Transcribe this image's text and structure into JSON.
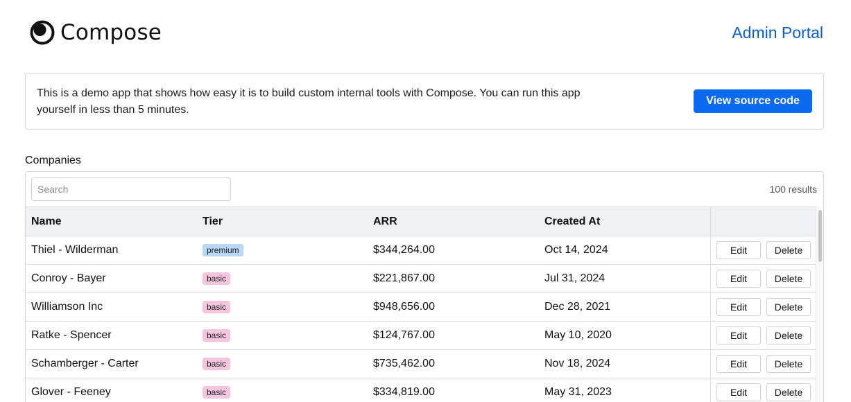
{
  "header": {
    "brand": "Compose",
    "portal_link": "Admin Portal"
  },
  "banner": {
    "text": "This is a demo app that shows how easy it is to build custom internal tools with Compose. You can run this app yourself in less than 5 minutes.",
    "button": "View source code"
  },
  "companies": {
    "title": "Companies",
    "search_placeholder": "Search",
    "results": "100 results",
    "columns": [
      "Name",
      "Tier",
      "ARR",
      "Created At"
    ],
    "edit_label": "Edit",
    "delete_label": "Delete",
    "rows": [
      {
        "name": "Thiel - Wilderman",
        "tier": "premium",
        "arr": "$344,264.00",
        "created": "Oct 14, 2024"
      },
      {
        "name": "Conroy - Bayer",
        "tier": "basic",
        "arr": "$221,867.00",
        "created": "Jul 31, 2024"
      },
      {
        "name": "Williamson Inc",
        "tier": "basic",
        "arr": "$948,656.00",
        "created": "Dec 28, 2021"
      },
      {
        "name": "Ratke - Spencer",
        "tier": "basic",
        "arr": "$124,767.00",
        "created": "May 10, 2020"
      },
      {
        "name": "Schamberger - Carter",
        "tier": "basic",
        "arr": "$735,462.00",
        "created": "Nov 18, 2024"
      },
      {
        "name": "Glover - Feeney",
        "tier": "basic",
        "arr": "$334,819.00",
        "created": "May 31, 2023"
      }
    ]
  },
  "colors": {
    "accent": "#0a6af0",
    "link": "#0b5fca",
    "premium_badge": "#b9d7f7",
    "basic_badge": "#f5c6de",
    "header_row": "#f1f2f5"
  }
}
